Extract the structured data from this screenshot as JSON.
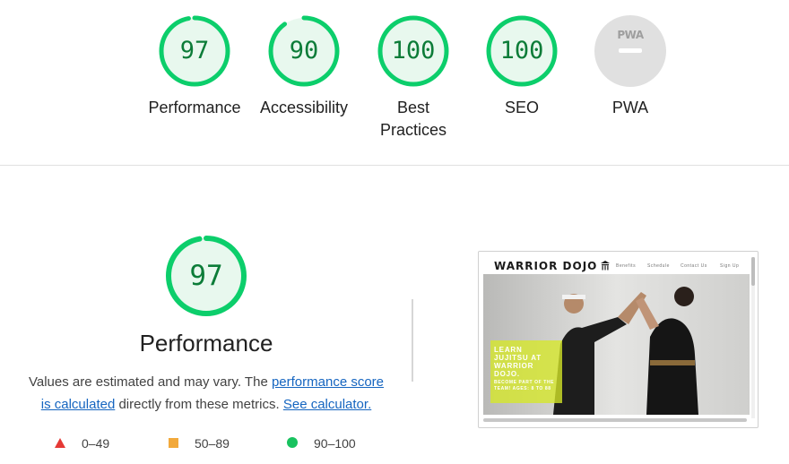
{
  "categories": [
    {
      "id": "performance",
      "score": "97",
      "score_value": 97,
      "label": "Performance",
      "color": "#0cce6b"
    },
    {
      "id": "accessibility",
      "score": "90",
      "score_value": 90,
      "label": "Accessibility",
      "color": "#0cce6b"
    },
    {
      "id": "best-practices",
      "score": "100",
      "score_value": 100,
      "label_line1": "Best",
      "label_line2": "Practices",
      "color": "#0cce6b"
    },
    {
      "id": "seo",
      "score": "100",
      "score_value": 100,
      "label": "SEO",
      "color": "#0cce6b"
    },
    {
      "id": "pwa",
      "badge_text": "PWA",
      "label": "PWA",
      "color": "#e0e0e0"
    }
  ],
  "performance_section": {
    "score": "97",
    "score_value": 97,
    "title": "Performance",
    "desc_prefix": "Values are estimated and may vary. The ",
    "link_score": "performance score is calculated",
    "desc_middle": " directly from these metrics. ",
    "link_calculator": "See calculator."
  },
  "legend": [
    {
      "range": "0–49",
      "shape": "triangle",
      "color": "#e53935"
    },
    {
      "range": "50–89",
      "shape": "square",
      "color": "#f2a93b"
    },
    {
      "range": "90–100",
      "shape": "circle",
      "color": "#18c25f"
    }
  ],
  "screenshot": {
    "brand": "WARRIOR DOJO",
    "nav": [
      "Benefits",
      "Schedule",
      "Contact Us",
      "Sign Up"
    ],
    "promo_title": "LEARN JUJITSU AT WARRIOR DOJO.",
    "promo_sub": "BECOME PART OF THE TEAM! AGES: 8 TO 88"
  }
}
